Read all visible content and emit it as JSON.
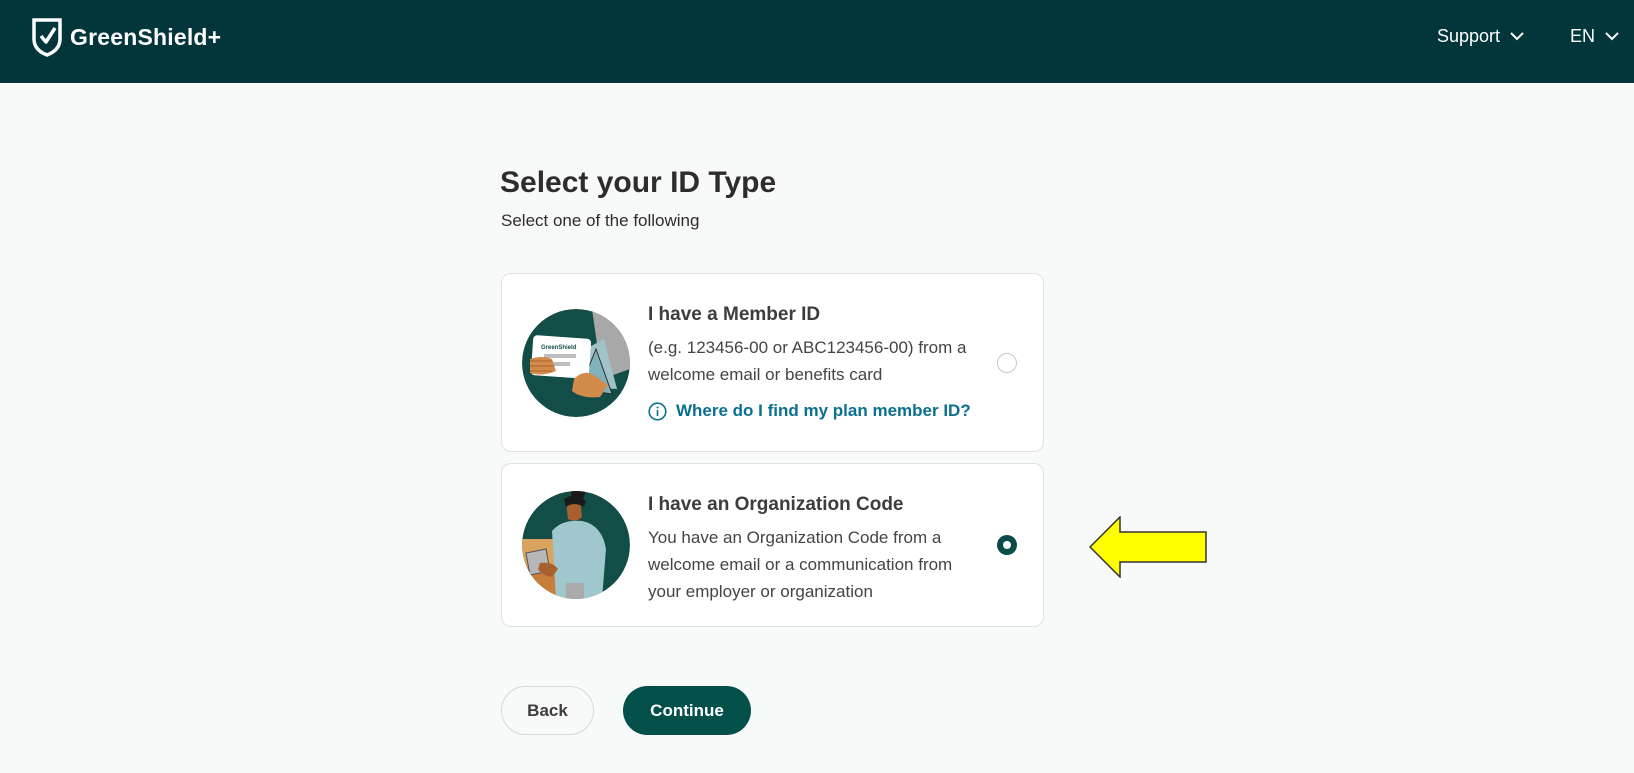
{
  "header": {
    "brand": "GreenShield+",
    "nav": [
      {
        "label": "Support"
      },
      {
        "label": "EN"
      }
    ]
  },
  "page": {
    "title": "Select your ID Type",
    "subtitle": "Select one of the following"
  },
  "options": [
    {
      "title": "I have a Member ID",
      "description": "(e.g. 123456-00 or ABC123456-00) from a welcome email or benefits card",
      "help_link": "Where do I find my plan member ID?",
      "selected": false,
      "illustration_card_text": "GreenShield"
    },
    {
      "title": "I have an Organization Code",
      "description": "You have an Organization Code from a welcome email or a communication from your employer or organization",
      "selected": true
    }
  ],
  "buttons": {
    "back": "Back",
    "continue": "Continue"
  },
  "colors": {
    "header_bg": "#02363b",
    "primary": "#03504a",
    "link": "#0b6f8f",
    "annotation_arrow": "#ffff00"
  }
}
